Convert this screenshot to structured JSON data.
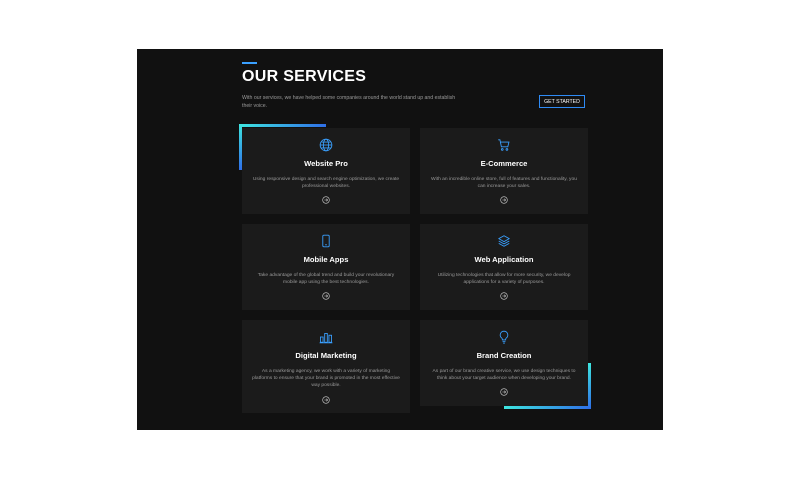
{
  "header": {
    "title": "OUR SERVICES",
    "intro": "With our services, we have helped some companies around the world stand up and establish their voice.",
    "cta_label": "GET STARTED"
  },
  "colors": {
    "accent": "#3aa0ff",
    "gradient_start": "#3ee6e0",
    "gradient_end": "#2f6fe8",
    "panel_bg": "#111111",
    "card_bg": "#1b1b1b"
  },
  "cards": [
    {
      "title": "Website Pro",
      "desc": "Using responsive design and search engine optimization, we create professional websites.",
      "icon": "globe-icon"
    },
    {
      "title": "E-Commerce",
      "desc": "With an incredible online store, full of features and functionality, you can increase your sales.",
      "icon": "shopping-cart-icon"
    },
    {
      "title": "Mobile Apps",
      "desc": "Take advantage of the global trend and build your revolutionary mobile app using the best technologies.",
      "icon": "smartphone-icon"
    },
    {
      "title": "Web Application",
      "desc": "Utilizing technologies that allow for more security, we develop applications for a variety of purposes.",
      "icon": "layers-icon"
    },
    {
      "title": "Digital Marketing",
      "desc": "As a marketing agency, we work with a variety of marketing platforms to ensure that your brand is promoted in the most effective way possible.",
      "icon": "bar-chart-icon"
    },
    {
      "title": "Brand Creation",
      "desc": "As part of our brand creative service, we use design techniques to think about your target audience when developing your brand.",
      "icon": "lightbulb-icon"
    }
  ]
}
